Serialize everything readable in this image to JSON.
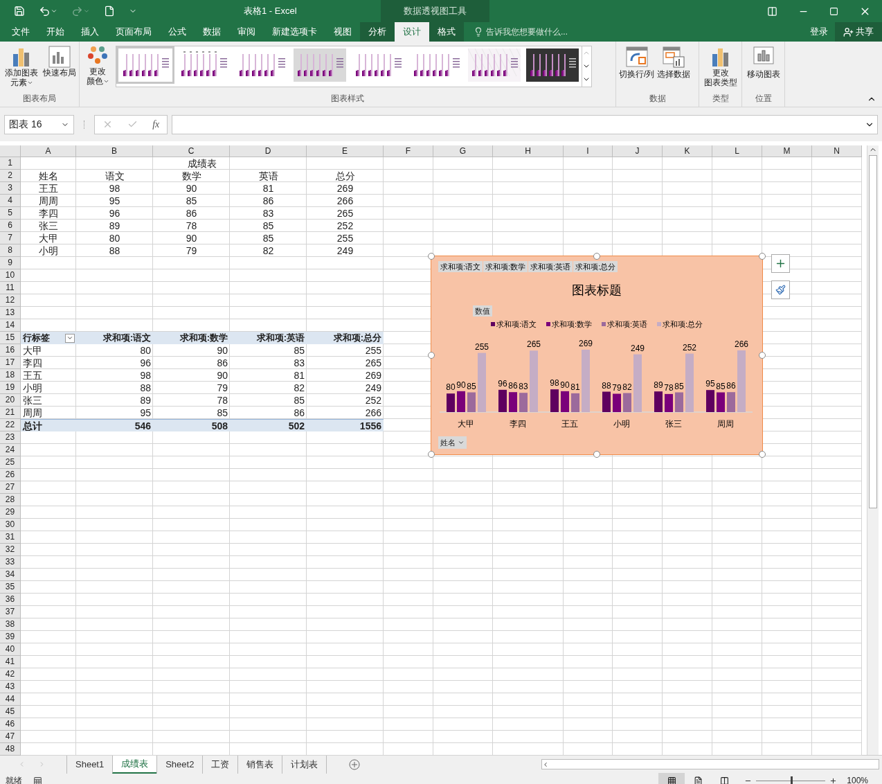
{
  "title_bar": {
    "title": "表格1 - Excel",
    "context_title": "数据透视图工具"
  },
  "ribbon_tabs": [
    {
      "label": "文件",
      "selected": false,
      "contextual": false
    },
    {
      "label": "开始",
      "selected": false,
      "contextual": false
    },
    {
      "label": "插入",
      "selected": false,
      "contextual": false
    },
    {
      "label": "页面布局",
      "selected": false,
      "contextual": false
    },
    {
      "label": "公式",
      "selected": false,
      "contextual": false
    },
    {
      "label": "数据",
      "selected": false,
      "contextual": false
    },
    {
      "label": "审阅",
      "selected": false,
      "contextual": false
    },
    {
      "label": "新建选项卡",
      "selected": false,
      "contextual": false
    },
    {
      "label": "视图",
      "selected": false,
      "contextual": false
    },
    {
      "label": "分析",
      "selected": false,
      "contextual": true
    },
    {
      "label": "设计",
      "selected": true,
      "contextual": true
    },
    {
      "label": "格式",
      "selected": false,
      "contextual": true
    }
  ],
  "tell_me": "告诉我您想要做什么...",
  "sign_in": "登录",
  "share": "共享",
  "ribbon": {
    "chart_layout": {
      "add_element": [
        "添加图表",
        "元素"
      ],
      "quick_layout": "快速布局",
      "label": "图表布局"
    },
    "chart_styles": {
      "change_colors": [
        "更改",
        "颜色"
      ],
      "label": "图表样式",
      "styles": [
        {
          "kind": "plain",
          "selected": true
        },
        {
          "kind": "labeled",
          "selected": false
        },
        {
          "kind": "dotted",
          "selected": false
        },
        {
          "kind": "gradient",
          "selected": false
        },
        {
          "kind": "soft",
          "selected": false
        },
        {
          "kind": "plain",
          "selected": false
        },
        {
          "kind": "hatched",
          "selected": false
        },
        {
          "kind": "dark",
          "selected": false
        }
      ]
    },
    "data": {
      "switch": "切换行/列",
      "select": "选择数据",
      "label": "数据"
    },
    "type": {
      "change_type": [
        "更改",
        "图表类型"
      ],
      "label": "类型"
    },
    "location": {
      "move": "移动图表",
      "label": "位置"
    }
  },
  "formula_bar": {
    "name_box": "图表 16",
    "function_symbol": "fx"
  },
  "sheet": {
    "columns": [
      "A",
      "B",
      "C",
      "D",
      "E",
      "F",
      "G",
      "H",
      "I",
      "J",
      "K",
      "L",
      "M",
      "N"
    ],
    "row_headers": [
      "1",
      "2",
      "3",
      "4",
      "5",
      "6",
      "7",
      "8",
      "9",
      "10",
      "11",
      "12",
      "13",
      "14",
      "15",
      "16",
      "17",
      "18",
      "19",
      "20",
      "21",
      "22",
      "23",
      "24",
      "25",
      "26",
      "27",
      "28",
      "29",
      "30",
      "31",
      "32",
      "33",
      "34",
      "35",
      "36",
      "37",
      "38",
      "39",
      "40",
      "41",
      "42",
      "43",
      "44",
      "45",
      "46",
      "47",
      "48"
    ],
    "rows": [
      {
        "kind": "title",
        "cells": [
          "成绩表"
        ]
      },
      {
        "kind": "plain",
        "cells": [
          "姓名",
          "语文",
          "数学",
          "英语",
          "总分"
        ]
      },
      {
        "kind": "plain",
        "cells": [
          "王五",
          "98",
          "90",
          "81",
          "269"
        ]
      },
      {
        "kind": "plain",
        "cells": [
          "周周",
          "95",
          "85",
          "86",
          "266"
        ]
      },
      {
        "kind": "plain",
        "cells": [
          "李四",
          "96",
          "86",
          "83",
          "265"
        ]
      },
      {
        "kind": "plain",
        "cells": [
          "张三",
          "89",
          "78",
          "85",
          "252"
        ]
      },
      {
        "kind": "plain",
        "cells": [
          "大甲",
          "80",
          "90",
          "85",
          "255"
        ]
      },
      {
        "kind": "plain",
        "cells": [
          "小明",
          "88",
          "79",
          "82",
          "249"
        ]
      },
      {
        "kind": "empty"
      },
      {
        "kind": "empty"
      },
      {
        "kind": "empty"
      },
      {
        "kind": "empty"
      },
      {
        "kind": "empty"
      },
      {
        "kind": "empty"
      },
      {
        "kind": "pivot_header",
        "cells": [
          "行标签",
          "求和项:语文",
          "求和项:数学",
          "求和项:英语",
          "求和项:总分"
        ]
      },
      {
        "kind": "pivot",
        "cells": [
          "大甲",
          "80",
          "90",
          "85",
          "255"
        ]
      },
      {
        "kind": "pivot",
        "cells": [
          "李四",
          "96",
          "86",
          "83",
          "265"
        ]
      },
      {
        "kind": "pivot",
        "cells": [
          "王五",
          "98",
          "90",
          "81",
          "269"
        ]
      },
      {
        "kind": "pivot",
        "cells": [
          "小明",
          "88",
          "79",
          "82",
          "249"
        ]
      },
      {
        "kind": "pivot",
        "cells": [
          "张三",
          "89",
          "78",
          "85",
          "252"
        ]
      },
      {
        "kind": "pivot",
        "cells": [
          "周周",
          "95",
          "85",
          "86",
          "266"
        ]
      },
      {
        "kind": "pivot_total",
        "cells": [
          "总计",
          "546",
          "508",
          "502",
          "1556"
        ]
      }
    ]
  },
  "chart": {
    "value_buttons": [
      "求和项:语文",
      "求和项:数学",
      "求和项:英语",
      "求和项:总分"
    ],
    "values_button": "数值",
    "axis_button": "姓名",
    "chart_data": {
      "type": "bar",
      "title": "图表标题",
      "categories": [
        "大甲",
        "李四",
        "王五",
        "小明",
        "张三",
        "周周"
      ],
      "data_labels": true,
      "series": [
        {
          "name": "求和项:语文",
          "color": "#5f005f",
          "values": [
            80,
            96,
            98,
            88,
            89,
            95
          ]
        },
        {
          "name": "求和项:数学",
          "color": "#7a007a",
          "values": [
            90,
            86,
            90,
            79,
            78,
            85
          ]
        },
        {
          "name": "求和项:英语",
          "color": "#9c6a9c",
          "values": [
            85,
            83,
            81,
            82,
            85,
            86
          ]
        },
        {
          "name": "求和项:总分",
          "color": "#c5adc5",
          "values": [
            255,
            265,
            269,
            249,
            252,
            266
          ]
        }
      ]
    }
  },
  "sheet_tabs": [
    {
      "label": "Sheet1",
      "selected": false
    },
    {
      "label": "成绩表",
      "selected": true
    },
    {
      "label": "Sheet2",
      "selected": false
    },
    {
      "label": "工资",
      "selected": false
    },
    {
      "label": "销售表",
      "selected": false
    },
    {
      "label": "计划表",
      "selected": false
    }
  ],
  "status_bar": {
    "status": "就绪",
    "views": [
      {
        "kind": "normal",
        "selected": true
      },
      {
        "kind": "page_layout",
        "selected": false
      },
      {
        "kind": "page_break",
        "selected": false
      }
    ],
    "zoom": {
      "level": 0.5,
      "reading": "100%"
    }
  }
}
